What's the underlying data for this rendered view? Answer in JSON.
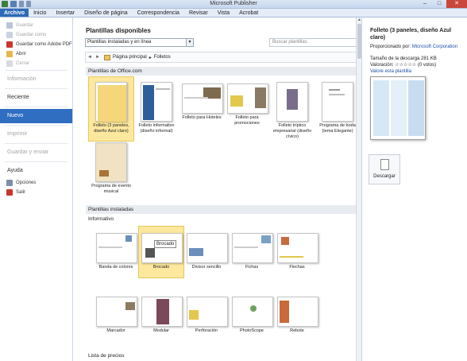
{
  "app_title": "Microsoft Publisher",
  "ribbon_tabs": [
    "Archivo",
    "Inicio",
    "Insertar",
    "Diseño de página",
    "Correspondencia",
    "Revisar",
    "Vista",
    "Acrobat"
  ],
  "left_menu": {
    "items_top": [
      {
        "label": "Guardar",
        "disabled": true
      },
      {
        "label": "Guardar como",
        "disabled": true
      },
      {
        "label": "Guardar como Adobe PDF",
        "disabled": false
      },
      {
        "label": "Abrir",
        "disabled": false
      },
      {
        "label": "Cerrar",
        "disabled": true
      }
    ],
    "sections": [
      "Información",
      "Reciente",
      "Nuevo",
      "Imprimir",
      "Guardar y enviar",
      "Ayuda"
    ],
    "items_bottom": [
      {
        "label": "Opciones",
        "disabled": false
      },
      {
        "label": "Salir",
        "disabled": false
      }
    ]
  },
  "main": {
    "heading": "Plantillas disponibles",
    "dropdown_value": "Plantillas instaladas y en línea",
    "search_placeholder": "Buscar plantillas",
    "breadcrumb": {
      "home": "Página principal",
      "current": "Folletos"
    },
    "office_section": "Plantillas de Office.com",
    "office_templates": [
      "Folleto (3 paneles, diseño Azul claro)",
      "Folleto informativo (diseño informal)",
      "Folleto para Hoteles",
      "Folleto para promociones",
      "Folleto tríptico empresarial (diseño cívico)",
      "Programa de boda (tema Elegante)",
      "Programa de evento musical"
    ],
    "installed_section": "Plantillas instaladas",
    "informativo_label": "Informativo",
    "installed_templates": [
      "Banda de colores",
      "Brocado",
      "Divisor sencillo",
      "Fichas",
      "Flechas",
      "Marcador",
      "Modular",
      "Perforación",
      "PhotoScope",
      "Rebote"
    ],
    "tooltip": "Brocado",
    "bottom_label": "Lista de precios"
  },
  "panel": {
    "title": "Folleto (3 paneles, diseño Azul claro)",
    "provider_label": "Proporcionado por:",
    "provider": "Microsoft Corporation",
    "size": "Tamaño de la descarga 281 KB",
    "rating_label": "Valoración:",
    "rating_stars": "☆☆☆☆☆",
    "votes": "(0 votos)",
    "rate_link": "Valore esta plantilla",
    "download": "Descargar"
  }
}
